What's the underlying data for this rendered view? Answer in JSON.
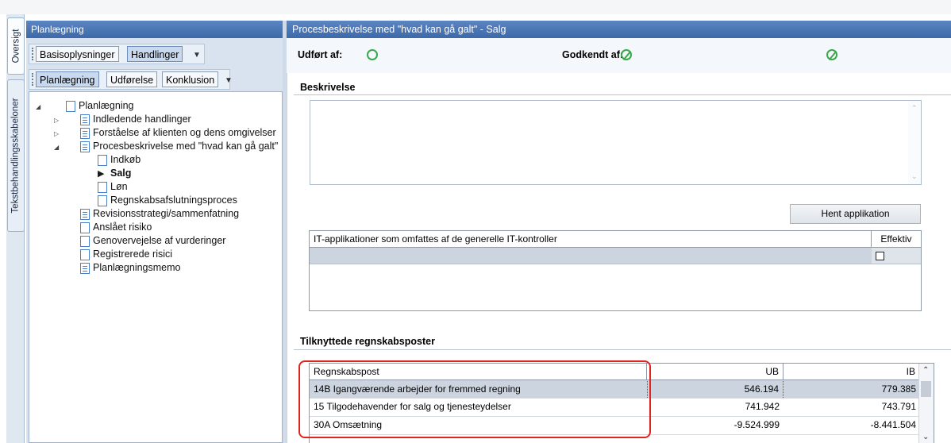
{
  "vertical_tabs": [
    {
      "label": "Oversigt",
      "selected": true
    },
    {
      "label": "Tekstbehandlingsskabeloner",
      "selected": false
    }
  ],
  "left_panel": {
    "title": "Planlægning",
    "toolbar1": [
      "Basisoplysninger",
      "Handlinger"
    ],
    "toolbar2": [
      "Planlægning",
      "Udførelse",
      "Konklusion"
    ],
    "tree": [
      {
        "label": "Planlægning",
        "level": 0,
        "expander": "expanded"
      },
      {
        "label": "Indledende handlinger",
        "level": 1,
        "expander": "collapsed"
      },
      {
        "label": "Forståelse af klienten og dens omgivelser",
        "level": 1,
        "expander": "collapsed"
      },
      {
        "label": "Procesbeskrivelse med \"hvad kan gå galt\"",
        "level": 1,
        "expander": "expanded"
      },
      {
        "label": "Indkøb",
        "level": 2
      },
      {
        "label": "Salg",
        "level": 2,
        "selected": true
      },
      {
        "label": "Løn",
        "level": 2
      },
      {
        "label": "Regnskabsafslutningsproces",
        "level": 2
      },
      {
        "label": "Revisionsstrategi/sammenfatning",
        "level": 1
      },
      {
        "label": "Anslået risiko",
        "level": 1
      },
      {
        "label": "Genovervejelse af vurderinger",
        "level": 1
      },
      {
        "label": "Registrerede risici",
        "level": 1
      },
      {
        "label": "Planlægningsmemo",
        "level": 1
      }
    ]
  },
  "right_panel": {
    "title": "Procesbeskrivelse med \"hvad kan gå galt\" - Salg",
    "udfoert_label": "Udført af:",
    "godkendt_label": "Godkendt af:",
    "beskrivelse_label": "Beskrivelse",
    "beskrivelse_text": "",
    "hent_button": "Hent applikation",
    "it_table": {
      "headers": [
        "IT-applikationer som omfattes af de generelle IT-kontroller",
        "Effektiv"
      ]
    },
    "tilknyttede_label": "Tilknyttede regnskabsposter",
    "regnskab_table": {
      "headers": [
        "Regnskabspost",
        "UB",
        "IB"
      ],
      "rows": [
        {
          "post": "14B Igangværende arbejder for fremmed regning",
          "ub": "546.194",
          "ib": "779.385"
        },
        {
          "post": "15 Tilgodehavender for salg og tjenesteydelser",
          "ub": "741.942",
          "ib": "743.791"
        },
        {
          "post": "30A Omsætning",
          "ub": "-9.524.999",
          "ib": "-8.441.504"
        }
      ]
    }
  },
  "colors": {
    "header_blue": "#4a76b5",
    "status_green": "#39a84a",
    "highlight_red": "#e0251e"
  }
}
